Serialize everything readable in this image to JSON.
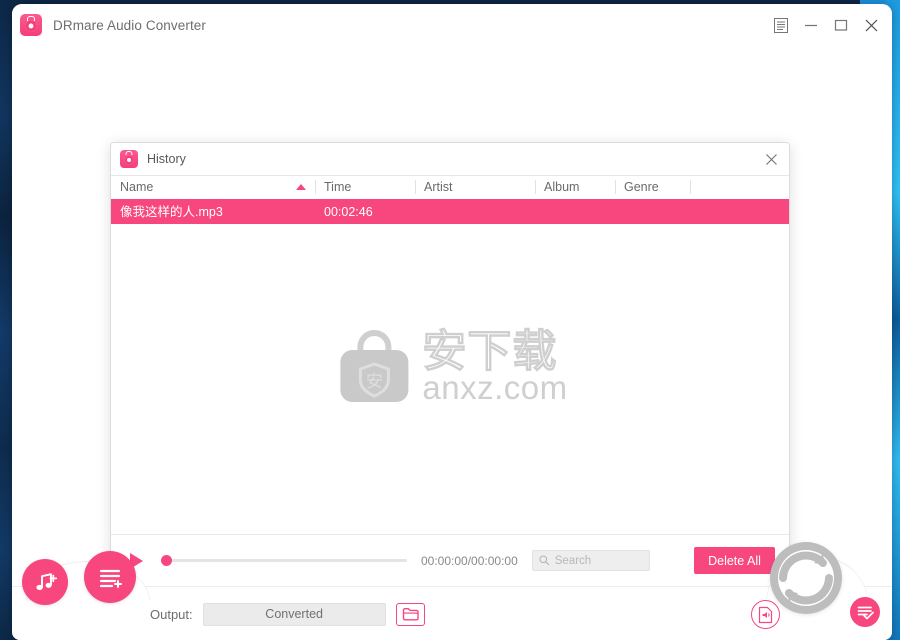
{
  "window": {
    "app_title": "DRmare Audio Converter",
    "app_icon": "drmare-logo-icon",
    "controls": {
      "menu_label": "menu-icon",
      "minimize_label": "minimize-icon",
      "maximize_label": "maximize-icon",
      "close_label": "close-icon"
    }
  },
  "history_dialog": {
    "title": "History",
    "icon": "drmare-logo-icon",
    "close_label": "close-icon",
    "columns": [
      {
        "label": "Name",
        "sorted": "asc"
      },
      {
        "label": "Time",
        "sorted": ""
      },
      {
        "label": "Artist",
        "sorted": ""
      },
      {
        "label": "Album",
        "sorted": ""
      },
      {
        "label": "Genre",
        "sorted": ""
      }
    ],
    "rows": [
      {
        "name": "像我这样的人.mp3",
        "time": "00:02:46",
        "artist": "",
        "album": "",
        "genre": "",
        "selected": true
      }
    ],
    "watermark": {
      "cn_text": "安下载",
      "domain_text": "anxz.com",
      "bag_glyph": "安"
    },
    "player": {
      "play_label": "play-icon",
      "seek_value": 0,
      "time_display": "00:00:00/00:00:00"
    },
    "search": {
      "placeholder": "Search",
      "value": "",
      "icon": "search-icon"
    },
    "delete_all_label": "Delete All"
  },
  "bottom_bar": {
    "add_music_label": "add-music-icon",
    "add_list_label": "add-list-icon",
    "output_label": "Output:",
    "output_path": "Converted",
    "folder_label": "folder-icon",
    "convert_label": "convert-icon",
    "format_label": "format-settings-icon",
    "history_label": "history-icon"
  },
  "colors": {
    "accent": "#f8467f",
    "accent_light": "#fb5b8f",
    "text": "#6a6a6a",
    "desktop_dark": "#0d2747",
    "desktop_blue": "#1e9ae0",
    "watermark": "#cfcfcf"
  }
}
